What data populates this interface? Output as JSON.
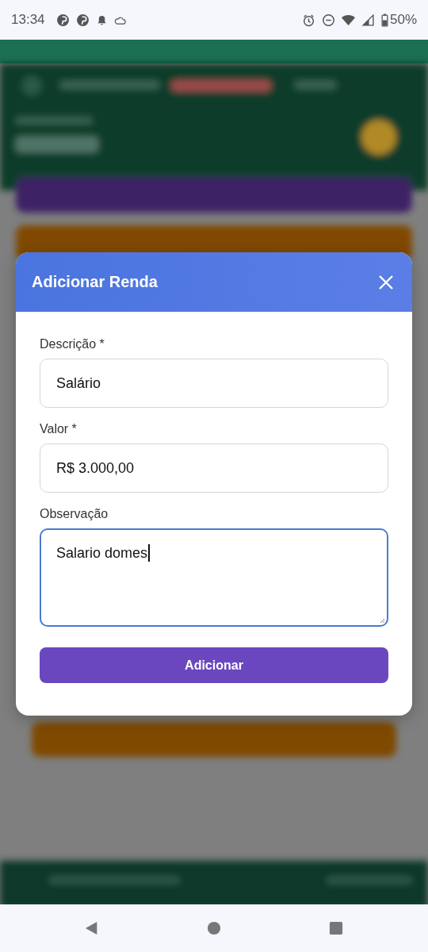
{
  "status_bar": {
    "time": "13:34",
    "battery": "50%"
  },
  "dialog": {
    "title": "Adicionar Renda",
    "fields": [
      {
        "kind": "input",
        "label": "Descrição *",
        "value": "Salário",
        "focused": false
      },
      {
        "kind": "input",
        "label": "Valor *",
        "value": "R$ 3.000,00",
        "focused": false
      },
      {
        "kind": "textarea",
        "label": "Observação",
        "value": "Salario domes",
        "focused": true
      }
    ],
    "submit": "Adicionar"
  }
}
